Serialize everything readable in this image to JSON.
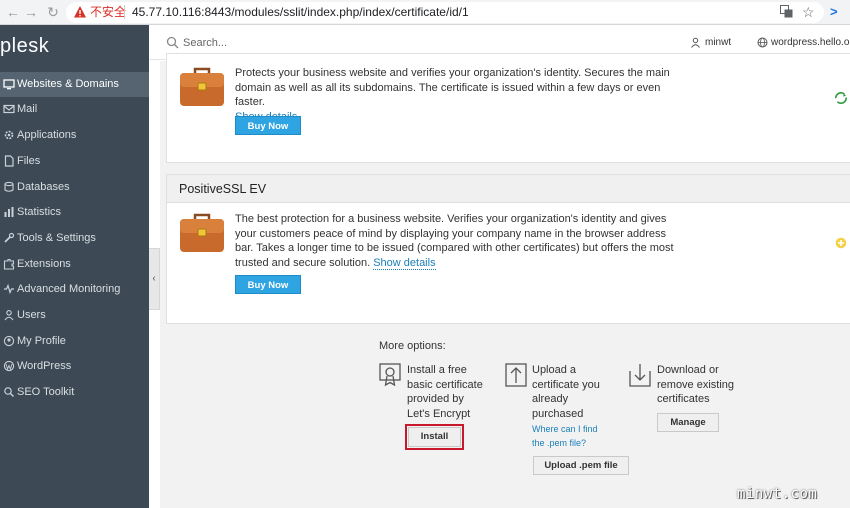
{
  "browser": {
    "insecure_label": "不安全",
    "url": "45.77.10.116:8443/modules/sslit/index.php/index/certificate/id/1"
  },
  "app": {
    "logo": "plesk"
  },
  "sidebar": {
    "items": [
      {
        "label": "Websites & Domains",
        "icon": "monitor-icon",
        "active": true
      },
      {
        "label": "Mail",
        "icon": "mail-icon"
      },
      {
        "label": "Applications",
        "icon": "gear-icon"
      },
      {
        "label": "Files",
        "icon": "file-icon"
      },
      {
        "label": "Databases",
        "icon": "database-icon"
      },
      {
        "label": "Statistics",
        "icon": "chart-icon"
      },
      {
        "label": "Tools & Settings",
        "icon": "tools-icon"
      },
      {
        "label": "Extensions",
        "icon": "puzzle-icon"
      },
      {
        "label": "Advanced Monitoring",
        "icon": "pulse-icon"
      },
      {
        "label": "Users",
        "icon": "user-icon"
      },
      {
        "label": "My Profile",
        "icon": "profile-icon"
      },
      {
        "label": "WordPress",
        "icon": "wordpress-icon"
      },
      {
        "label": "SEO Toolkit",
        "icon": "seo-icon"
      }
    ]
  },
  "header": {
    "search_placeholder": "Search...",
    "user": "minwt",
    "domain": "wordpress.hello.org"
  },
  "cards": [
    {
      "title": "",
      "description": "Protects your business website and verifies your organization's identity. Secures the main domain as well as all its subdomains. The certificate is issued within a few days or even faster.",
      "link": "Show details",
      "button": "Buy Now"
    },
    {
      "title": "PositiveSSL EV",
      "description": "The best protection for a business website. Verifies your organization's identity and gives your customers peace of mind by displaying your company name in the browser address bar. Takes a longer time to be issued (compared with other certificates) but offers the most trusted and secure solution.",
      "link": "Show details",
      "button": "Buy Now"
    }
  ],
  "more_options": {
    "title": "More options:",
    "options": [
      {
        "text": "Install a free basic certificate provided by Let's Encrypt",
        "button": "Install"
      },
      {
        "text": "Upload a certificate you already purchased",
        "link": "Where can I find the .pem file?",
        "button": "Upload .pem file"
      },
      {
        "text": "Download or remove existing certificates",
        "button": "Manage"
      }
    ]
  },
  "watermark": "minwt.com"
}
